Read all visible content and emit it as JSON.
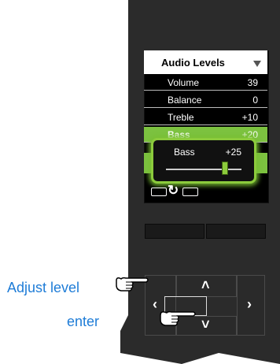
{
  "menu": {
    "title": "Audio Levels",
    "items": [
      {
        "label": "Volume",
        "value": "39"
      },
      {
        "label": "Balance",
        "value": "0"
      },
      {
        "label": "Treble",
        "value": "+10"
      },
      {
        "label": "Bass",
        "value": "+20"
      }
    ],
    "selected_index": 3
  },
  "popup": {
    "label": "Bass",
    "value": "+25",
    "level_fraction": 0.78
  },
  "annotations": {
    "adjust_label": "Adjust level",
    "enter_label": "enter"
  },
  "colors": {
    "highlight": "#7cc240",
    "annotation_text": "#1e7cd7",
    "device": "#2b2b2b"
  },
  "icons": {
    "title_dropdown": "triangle-down-icon",
    "back": "back-arrow-icon",
    "nav_up": "chevron-up-icon",
    "nav_down": "chevron-down-icon",
    "nav_left": "chevron-left-icon",
    "nav_right": "chevron-right-icon",
    "hand": "pointing-hand-icon"
  }
}
